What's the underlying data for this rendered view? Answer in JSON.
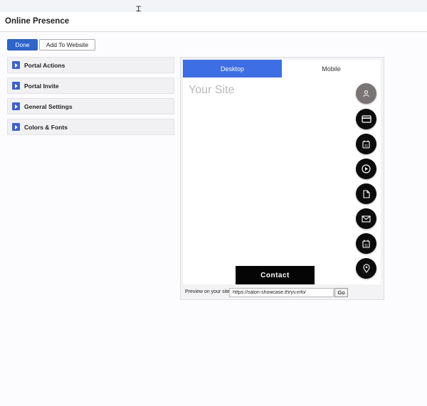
{
  "header": {
    "title": "Online Presence"
  },
  "toolbar": {
    "done_label": "Done",
    "add_label": "Add To Website"
  },
  "sections": [
    {
      "label": "Portal Actions"
    },
    {
      "label": "Portal Invite"
    },
    {
      "label": "General Settings"
    },
    {
      "label": "Colors & Fonts"
    }
  ],
  "preview": {
    "tabs": [
      {
        "label": "Desktop",
        "active": true
      },
      {
        "label": "Mobile",
        "active": false
      }
    ],
    "site_title": "Your Site",
    "contact_label": "Contact",
    "fab_icons": [
      "user-icon",
      "credit-card-icon",
      "calendar-icon",
      "play-icon",
      "document-icon",
      "mail-icon",
      "calendar-icon",
      "location-pin-icon"
    ],
    "preview_label": "Preview on your site",
    "url_value": "https://salon-showcase.thryv.info/",
    "go_label": "Go"
  },
  "colors": {
    "primary": "#2f65c9",
    "tab_active": "#3e6ee3",
    "fab": "#0c0c0c",
    "fab_user": "#7a7574"
  }
}
